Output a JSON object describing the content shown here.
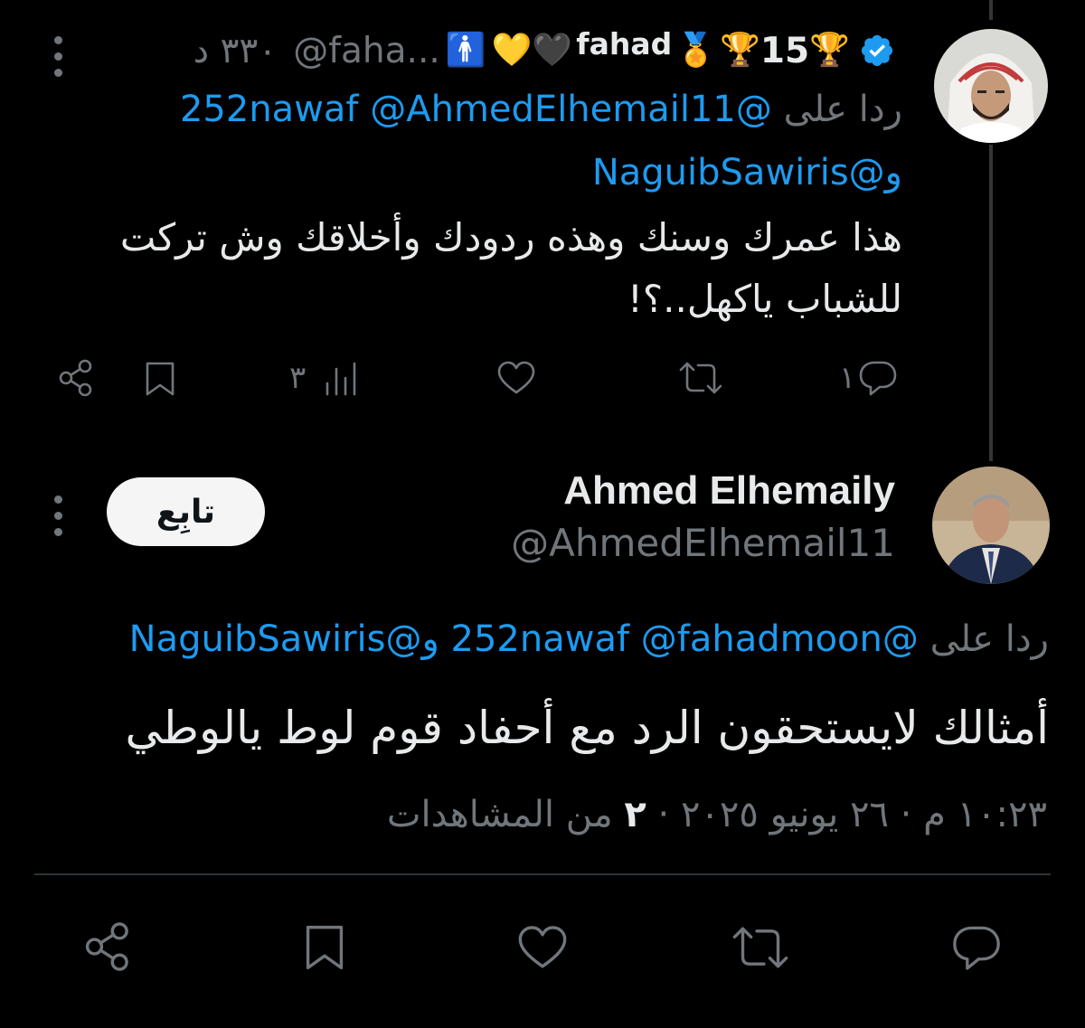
{
  "tweet1": {
    "display_name": "fahad",
    "badge_count": "15",
    "handle": "@faha...",
    "time": "٣٣٠ د",
    "reply_label": "ردا على",
    "mention_1": "@252nawaf",
    "mention_2": "@AhmedElhemail11",
    "mention_3": "@NaguibSawiris",
    "mention_conj": "و",
    "text_line1": "هذا عمرك وسنك وهذه ردودك وأخلاقك وش تركت",
    "text_line2": "للشباب ياكهل..؟!",
    "reply_count": "١",
    "views_count": "٣",
    "icons": [
      "verified-icon",
      "trophy-icon",
      "medal-icon",
      "black-heart-icon",
      "yellow-heart-icon",
      "more-icon",
      "reply-icon",
      "retweet-icon",
      "like-icon",
      "views-icon",
      "bookmark-icon",
      "share-icon"
    ]
  },
  "tweet2": {
    "display_name": "Ahmed Elhemaily",
    "handle": "@AhmedElhemail11",
    "follow_label": "تابِع",
    "reply_label": "ردا على",
    "mention_1": "@252nawaf",
    "mention_2": "@fahadmoon",
    "mention_3": "@NaguibSawiris",
    "mention_conj": "و",
    "text": "أمثالك لايستحقون الرد مع أحفاد قوم لوط يالوطي",
    "time": "١٠:٢٣ م",
    "sep": "·",
    "date": "٢٦ يونيو ٢٠٢٥",
    "views_count": "٢",
    "views_label": "من المشاهدات"
  },
  "colors": {
    "background": "#000000",
    "text": "#e7e9ea",
    "muted": "#71767b",
    "accent": "#1d9bf0",
    "line": "#333639"
  }
}
